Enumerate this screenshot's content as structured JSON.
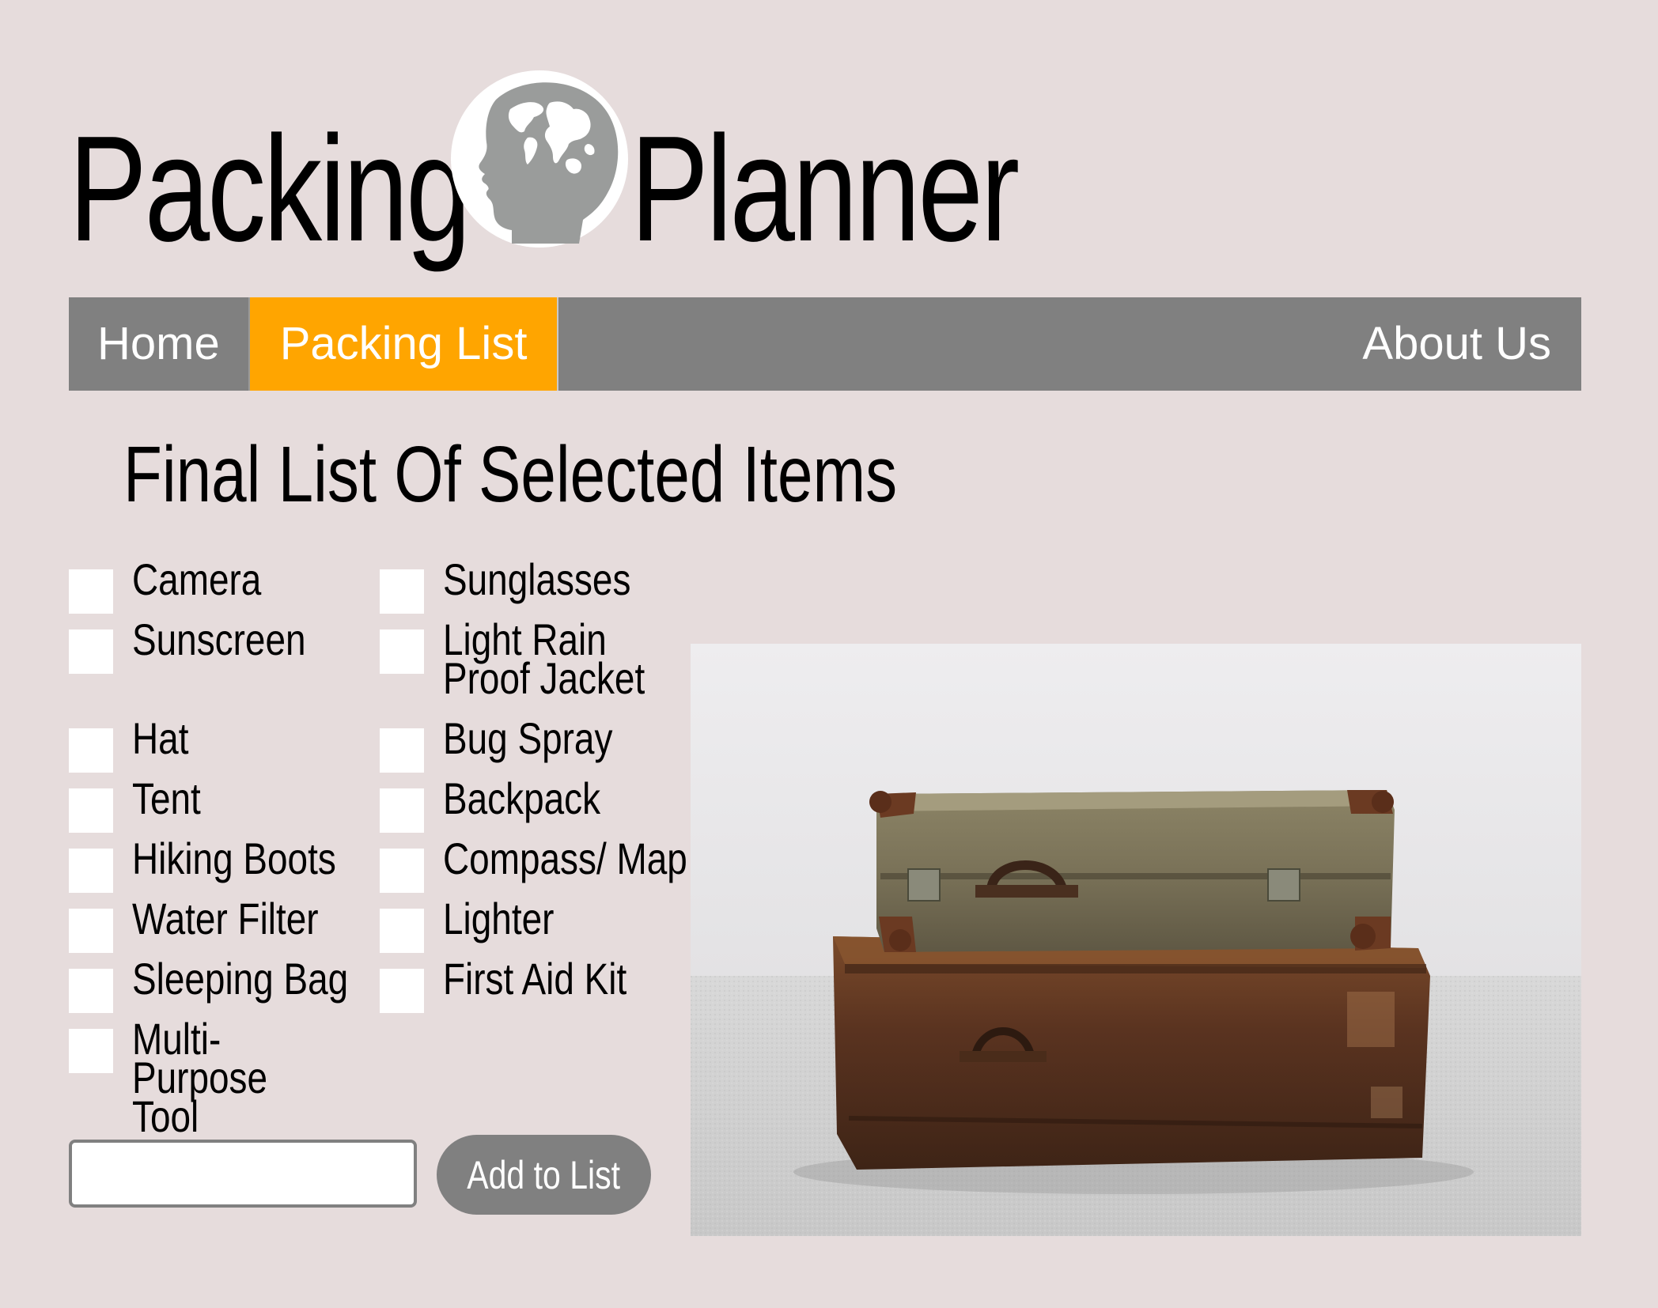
{
  "header": {
    "title_left": "Packing",
    "title_right": "Planner",
    "logo_icon": "globe-head-icon"
  },
  "nav": {
    "items": [
      {
        "label": "Home",
        "active": false
      },
      {
        "label": "Packing List",
        "active": true
      },
      {
        "label": "About Us",
        "active": false
      }
    ],
    "active_color": "#ffa500",
    "bar_color": "#808080"
  },
  "main": {
    "title": "Final List Of Selected Items",
    "checklist": {
      "left_column": [
        "Camera",
        "Sunscreen",
        "Hat",
        "Tent",
        "Hiking Boots",
        "Water Filter",
        "Sleeping Bag",
        "Multi-Purpose Tool"
      ],
      "right_column": [
        "Sunglasses",
        "Light Rain Proof Jacket",
        "Bug Spray",
        "Backpack",
        "Compass/ Map",
        "Lighter",
        "First Aid Kit"
      ]
    },
    "new_item": {
      "value": "",
      "placeholder": ""
    },
    "add_button_label": "Add to List",
    "photo_subject": "stacked-vintage-suitcases-image"
  },
  "colors": {
    "background": "#e6dcdc",
    "button": "#808080",
    "accent": "#ffa500"
  }
}
